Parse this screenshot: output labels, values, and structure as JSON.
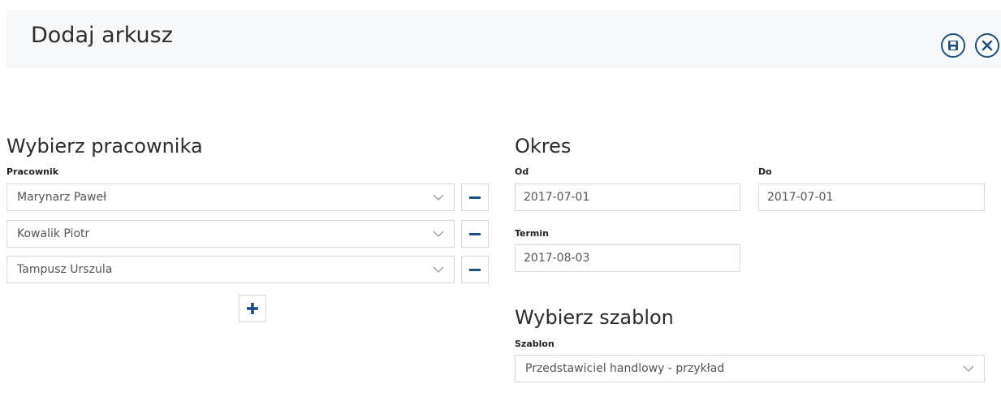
{
  "header": {
    "title": "Dodaj arkusz",
    "save_icon": "save-icon",
    "close_icon": "close-icon"
  },
  "employees_section": {
    "title": "Wybierz pracownika",
    "field_label": "Pracownik",
    "employees": [
      "Marynarz Paweł",
      "Kowalik Piotr",
      "Tampusz Urszula"
    ]
  },
  "period_section": {
    "title": "Okres",
    "from_label": "Od",
    "from_value": "2017-07-01",
    "to_label": "Do",
    "to_value": "2017-07-01",
    "deadline_label": "Termin",
    "deadline_value": "2017-08-03"
  },
  "template_section": {
    "title": "Wybierz szablon",
    "field_label": "Szablon",
    "value": "Przedstawiciel handlowy - przykład"
  },
  "colors": {
    "accent": "#1c4f87",
    "border": "#d6d9dc",
    "header_bg": "#f7f8f9"
  }
}
